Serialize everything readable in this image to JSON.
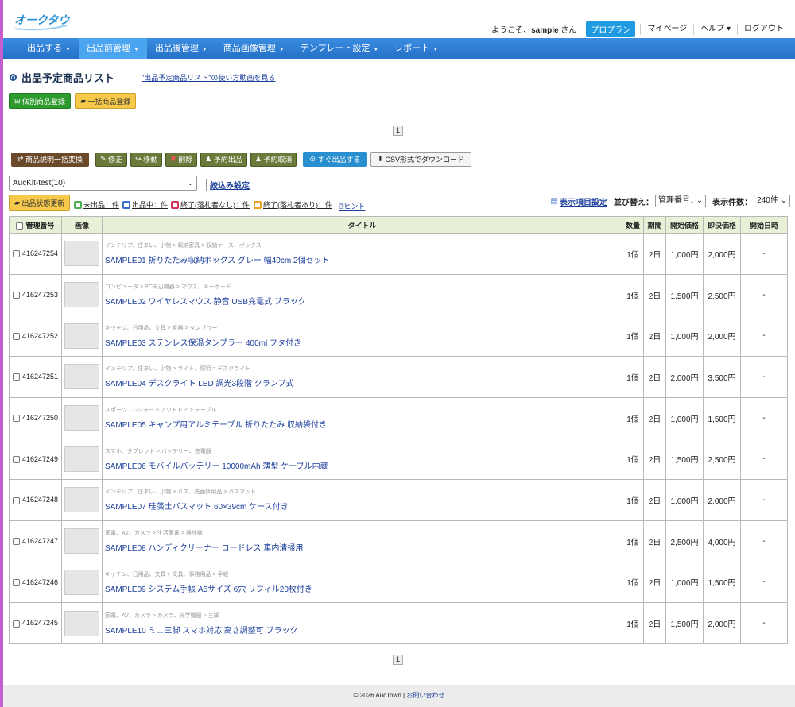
{
  "logo_text": "オークタウン",
  "header": {
    "welcome_prefix": "ようこそ、",
    "username": "sample",
    "welcome_suffix": " さん",
    "plan_label": "プロプラン",
    "links": [
      "マイページ",
      "ヘルプ ▾",
      "ログアウト"
    ]
  },
  "nav": [
    {
      "label": "出品する"
    },
    {
      "label": "出品前管理"
    },
    {
      "label": "出品後管理"
    },
    {
      "label": "商品画像管理"
    },
    {
      "label": "テンプレート設定"
    },
    {
      "label": "レポート"
    }
  ],
  "page": {
    "title": "出品予定商品リスト",
    "howto_link": "\"出品予定商品リスト\"の使い方動画を見る",
    "register_single": "個別商品登録",
    "register_bulk": "一括商品登録",
    "page_number": "1"
  },
  "toolbar": {
    "convert": "商品説明一括変換",
    "edit": "修正",
    "move": "移動",
    "delete": "削除",
    "reserve": "予約出品",
    "reserve_cancel": "予約取消",
    "list_now": "すぐ出品する",
    "csv": "CSV形式でダウンロード"
  },
  "filter": {
    "select_value": "AucKit-test(10)",
    "narrow_link": "絞込み設定",
    "status_update": "出品状態更新",
    "legend": [
      {
        "label": "未出品：件",
        "color": "#4caf50"
      },
      {
        "label": "出品中：件",
        "color": "#3a6fd0"
      },
      {
        "label": "終了(落札者なし)：件",
        "color": "#d0305a"
      },
      {
        "label": "終了(落札者あり)：件",
        "color": "#f0a020"
      }
    ],
    "hint": "ヒント",
    "display_settings": "表示項目設定",
    "sort_label": "並び替え：",
    "sort_value": "管理番号↓",
    "count_label": "表示件数：",
    "count_value": "240件"
  },
  "table": {
    "headers": [
      "管理番号",
      "画像",
      "タイトル",
      "数量",
      "期間",
      "開始価格",
      "即決価格",
      "開始日時"
    ],
    "rows": [
      {
        "id": "416247254",
        "category": "インテリア、住まい、小物 > 収納家具 > 収納ケース、ボックス",
        "title": "SAMPLE01 折りたたみ収納ボックス グレー 幅40cm 2個セット",
        "qty": "1個",
        "period": "2日",
        "start": "1,000円",
        "buyout": "2,000円",
        "date": "-"
      },
      {
        "id": "416247253",
        "category": "コンピュータ > PC周辺機器 > マウス、キーボード",
        "title": "SAMPLE02 ワイヤレスマウス 静音 USB充電式 ブラック",
        "qty": "1個",
        "period": "2日",
        "start": "1,500円",
        "buyout": "2,500円",
        "date": "-"
      },
      {
        "id": "416247252",
        "category": "キッチン、日用品、文具 > 食器 > タンブラー",
        "title": "SAMPLE03 ステンレス保温タンブラー 400ml フタ付き",
        "qty": "1個",
        "period": "2日",
        "start": "1,000円",
        "buyout": "2,000円",
        "date": "-"
      },
      {
        "id": "416247251",
        "category": "インテリア、住まい、小物 > ライト、照明 > デスクライト",
        "title": "SAMPLE04 デスクライト LED 調光3段階 クランプ式",
        "qty": "1個",
        "period": "2日",
        "start": "2,000円",
        "buyout": "3,500円",
        "date": "-"
      },
      {
        "id": "416247250",
        "category": "スポーツ、レジャー > アウトドア > テーブル",
        "title": "SAMPLE05 キャンプ用アルミテーブル 折りたたみ 収納袋付き",
        "qty": "1個",
        "period": "2日",
        "start": "1,000円",
        "buyout": "1,500円",
        "date": "-"
      },
      {
        "id": "416247249",
        "category": "スマホ、タブレット > バッテリー、充電器",
        "title": "SAMPLE06 モバイルバッテリー 10000mAh 薄型 ケーブル内蔵",
        "qty": "1個",
        "period": "2日",
        "start": "1,500円",
        "buyout": "2,500円",
        "date": "-"
      },
      {
        "id": "416247248",
        "category": "インテリア、住まい、小物 > バス、洗面所用品 > バスマット",
        "title": "SAMPLE07 珪藻土バスマット 60×39cm ケース付き",
        "qty": "1個",
        "period": "2日",
        "start": "1,000円",
        "buyout": "2,000円",
        "date": "-"
      },
      {
        "id": "416247247",
        "category": "家電、AV、カメラ > 生活家電 > 掃除機",
        "title": "SAMPLE08 ハンディクリーナー コードレス 車内清掃用",
        "qty": "1個",
        "period": "2日",
        "start": "2,500円",
        "buyout": "4,000円",
        "date": "-"
      },
      {
        "id": "416247246",
        "category": "キッチン、日用品、文具 > 文具、事務用品 > 手帳",
        "title": "SAMPLE09 システム手帳 A5サイズ 6穴 リフィル20枚付き",
        "qty": "1個",
        "period": "2日",
        "start": "1,000円",
        "buyout": "1,500円",
        "date": "-"
      },
      {
        "id": "416247245",
        "category": "家電、AV、カメラ > カメラ、光学機器 > 三脚",
        "title": "SAMPLE10 ミニ三脚 スマホ対応 高さ調整可 ブラック",
        "qty": "1個",
        "period": "2日",
        "start": "1,500円",
        "buyout": "2,000円",
        "date": "-"
      }
    ]
  },
  "footer": {
    "copyright": "© 2026 AucTown | ",
    "contact": "お問い合わせ"
  }
}
